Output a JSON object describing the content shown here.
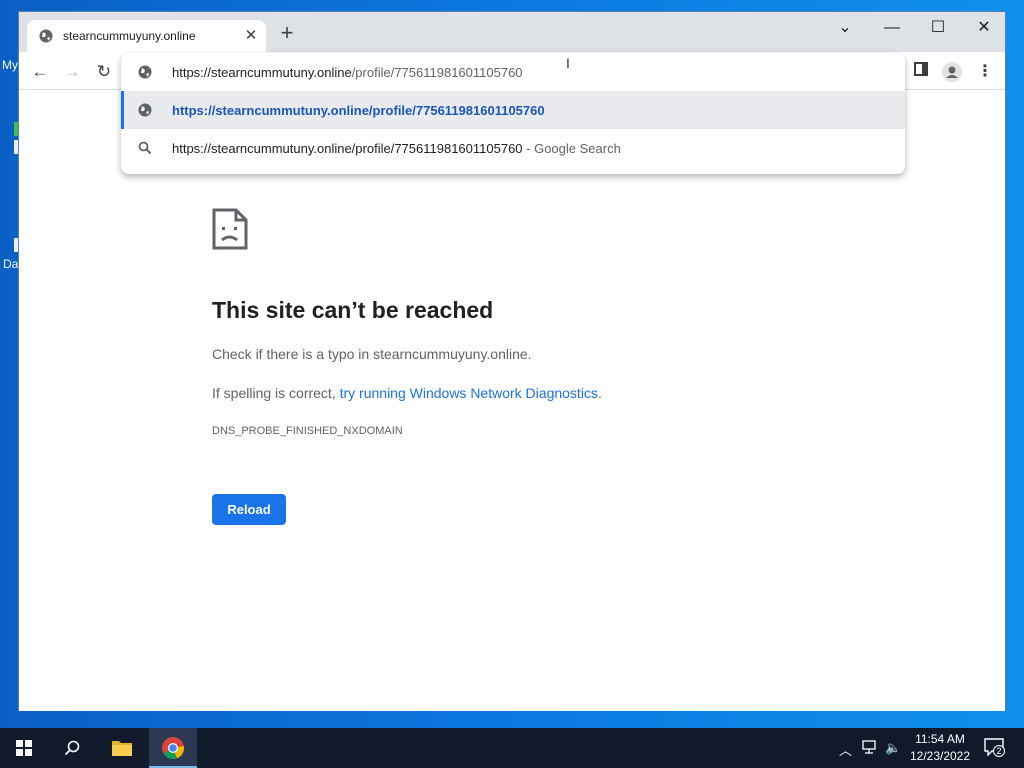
{
  "desktop": {
    "icon1_label": "My",
    "icon2_label": "Da"
  },
  "browser": {
    "tab": {
      "title": "stearncummuyuny.online"
    },
    "window_controls": {
      "minimize": "—",
      "maximize": "☐",
      "close": "✕",
      "tabsearch": "⌄"
    },
    "address": {
      "prefix": "https://stearncummutuny.online",
      "path": "/profile/775611981601105760"
    },
    "suggestions": [
      {
        "text": "https://stearncummutuny.online/profile/775611981601105760",
        "type": "url"
      },
      {
        "text": "https://stearncummutuny.online/profile/775611981601105760",
        "suffix": " - Google Search",
        "type": "search"
      }
    ]
  },
  "error_page": {
    "title": "This site can’t be reached",
    "line1": "Check if there is a typo in stearncummuyuny.online.",
    "line2_prefix": "If spelling is correct, ",
    "line2_link": "try running Windows Network Diagnostics",
    "line2_suffix": ".",
    "code": "DNS_PROBE_FINISHED_NXDOMAIN",
    "reload_label": "Reload"
  },
  "taskbar": {
    "time": "11:54 AM",
    "date": "12/23/2022",
    "notification_count": "2"
  },
  "colors": {
    "accent": "#1a73e8",
    "taskbar": "#101a2a"
  }
}
